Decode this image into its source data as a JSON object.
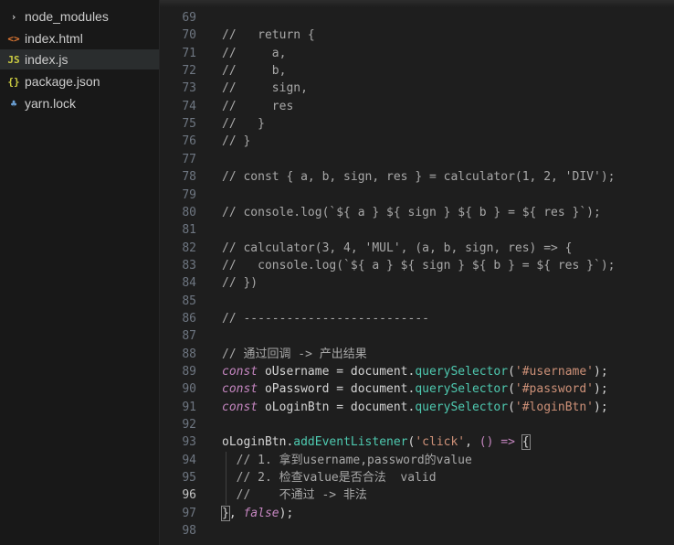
{
  "explorer": {
    "items": [
      {
        "icon": "›",
        "icon_name": "chevron-right-icon",
        "label": "node_modules",
        "icon_color": "#cccccc"
      },
      {
        "icon": "<>",
        "icon_name": "html-file-icon",
        "label": "index.html",
        "icon_color": "#e37933"
      },
      {
        "icon": "JS",
        "icon_name": "js-file-icon",
        "label": "index.js",
        "icon_color": "#cbcb41",
        "selected": true
      },
      {
        "icon": "{}",
        "icon_name": "json-file-icon",
        "label": "package.json",
        "icon_color": "#cbcb41"
      },
      {
        "icon": "♣",
        "icon_name": "yarn-file-icon",
        "label": "yarn.lock",
        "icon_color": "#6a9fd4"
      }
    ]
  },
  "editor": {
    "active_line": "96",
    "lines": [
      {
        "n": "69",
        "segs": []
      },
      {
        "n": "70",
        "segs": [
          {
            "t": "//   return {",
            "c": "comment"
          }
        ]
      },
      {
        "n": "71",
        "segs": [
          {
            "t": "//     a,",
            "c": "comment"
          }
        ]
      },
      {
        "n": "72",
        "segs": [
          {
            "t": "//     b,",
            "c": "comment"
          }
        ]
      },
      {
        "n": "73",
        "segs": [
          {
            "t": "//     sign,",
            "c": "comment"
          }
        ]
      },
      {
        "n": "74",
        "segs": [
          {
            "t": "//     res",
            "c": "comment"
          }
        ]
      },
      {
        "n": "75",
        "segs": [
          {
            "t": "//   }",
            "c": "comment"
          }
        ]
      },
      {
        "n": "76",
        "segs": [
          {
            "t": "// }",
            "c": "comment"
          }
        ]
      },
      {
        "n": "77",
        "segs": []
      },
      {
        "n": "78",
        "segs": [
          {
            "t": "// const { a, b, sign, res } = calculator(1, 2, 'DIV');",
            "c": "comment"
          }
        ]
      },
      {
        "n": "79",
        "segs": []
      },
      {
        "n": "80",
        "segs": [
          {
            "t": "// console.log(`${ a } ${ sign } ${ b } = ${ res }`);",
            "c": "comment"
          }
        ]
      },
      {
        "n": "81",
        "segs": []
      },
      {
        "n": "82",
        "segs": [
          {
            "t": "// calculator(3, 4, 'MUL', (a, b, sign, res) => {",
            "c": "comment"
          }
        ]
      },
      {
        "n": "83",
        "segs": [
          {
            "t": "//   console.log(`${ a } ${ sign } ${ b } = ${ res }`);",
            "c": "comment"
          }
        ]
      },
      {
        "n": "84",
        "segs": [
          {
            "t": "// })",
            "c": "comment"
          }
        ]
      },
      {
        "n": "85",
        "segs": []
      },
      {
        "n": "86",
        "segs": [
          {
            "t": "// --------------------------",
            "c": "comment"
          }
        ]
      },
      {
        "n": "87",
        "segs": []
      },
      {
        "n": "88",
        "segs": [
          {
            "t": "// 通过回调 -> 产出结果",
            "c": "comment"
          }
        ]
      },
      {
        "n": "89",
        "segs": [
          {
            "t": "const",
            "c": "kw"
          },
          {
            "t": " oUsername = document.",
            "c": "var"
          },
          {
            "t": "querySelector",
            "c": "method"
          },
          {
            "t": "(",
            "c": "punct"
          },
          {
            "t": "'#username'",
            "c": "str"
          },
          {
            "t": ");",
            "c": "punct"
          }
        ]
      },
      {
        "n": "90",
        "segs": [
          {
            "t": "const",
            "c": "kw"
          },
          {
            "t": " oPassword = document.",
            "c": "var"
          },
          {
            "t": "querySelector",
            "c": "method"
          },
          {
            "t": "(",
            "c": "punct"
          },
          {
            "t": "'#password'",
            "c": "str"
          },
          {
            "t": ");",
            "c": "punct"
          }
        ]
      },
      {
        "n": "91",
        "segs": [
          {
            "t": "const",
            "c": "kw"
          },
          {
            "t": " oLoginBtn = document.",
            "c": "var"
          },
          {
            "t": "querySelector",
            "c": "method"
          },
          {
            "t": "(",
            "c": "punct"
          },
          {
            "t": "'#loginBtn'",
            "c": "str"
          },
          {
            "t": ");",
            "c": "punct"
          }
        ]
      },
      {
        "n": "92",
        "segs": []
      },
      {
        "n": "93",
        "segs": [
          {
            "t": "oLoginBtn.",
            "c": "var"
          },
          {
            "t": "addEventListener",
            "c": "method"
          },
          {
            "t": "(",
            "c": "punct"
          },
          {
            "t": "'click'",
            "c": "str"
          },
          {
            "t": ", ",
            "c": "punct"
          },
          {
            "t": "() =>",
            "c": "arrow"
          },
          {
            "t": " ",
            "c": "punct"
          },
          {
            "t": "{",
            "c": "brace"
          }
        ]
      },
      {
        "n": "94",
        "segs": [
          {
            "t": "  // 1. 拿到username,password的value",
            "c": "comment"
          }
        ]
      },
      {
        "n": "95",
        "segs": [
          {
            "t": "  // 2. 检查value是否合法  valid",
            "c": "comment"
          }
        ]
      },
      {
        "n": "96",
        "segs": [
          {
            "t": "  //    不通过 -> 非法",
            "c": "comment"
          }
        ]
      },
      {
        "n": "97",
        "segs": [
          {
            "t": "}",
            "c": "brace"
          },
          {
            "t": ", ",
            "c": "punct"
          },
          {
            "t": "false",
            "c": "bool"
          },
          {
            "t": ");",
            "c": "punct"
          }
        ]
      },
      {
        "n": "98",
        "segs": []
      }
    ]
  }
}
